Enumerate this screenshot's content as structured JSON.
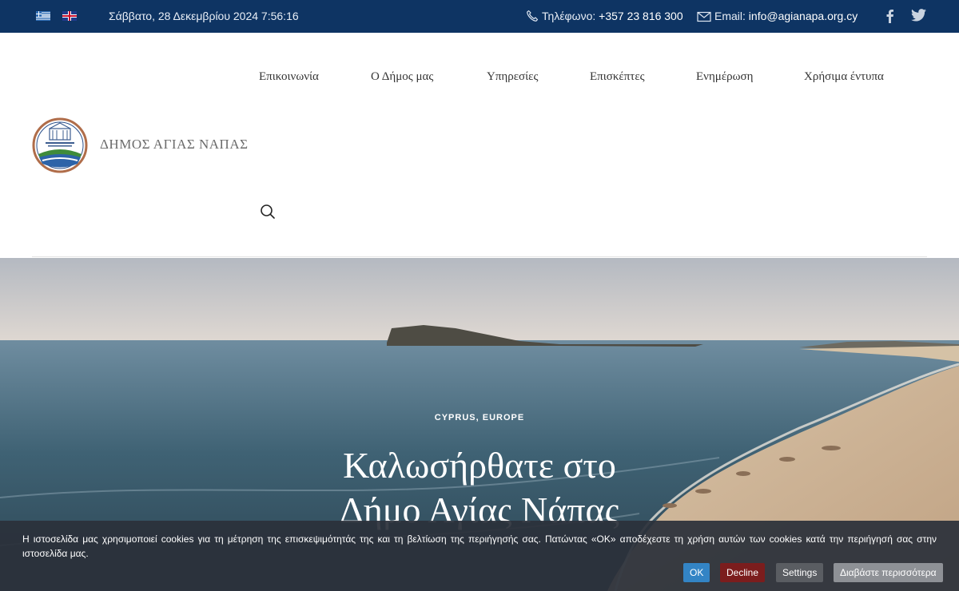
{
  "topbar": {
    "datetime": "Σάββατο, 28 Δεκεμβρίου 2024 7:56:16",
    "phone_label": "Τηλέφωνο:",
    "phone_number": "+357 23 816 300",
    "email_label": "Email:",
    "email_address": "info@agianapa.org.cy",
    "languages": [
      "greek-flag",
      "uk-flag"
    ],
    "social": [
      "facebook-icon",
      "twitter-icon"
    ],
    "bg_color": "#0e3463"
  },
  "nav": {
    "items": [
      "Επικοινωνία",
      "Ο Δήμος μας",
      "Υπηρεσίες",
      "Επισκέπτες",
      "Ενημέρωση",
      "Χρήσιμα έντυπα"
    ]
  },
  "brand": {
    "site_name": "ΔΗΜΟΣ ΑΓΙΑΣ ΝΑΠΑΣ"
  },
  "hero": {
    "category": "CYPRUS, EUROPE",
    "title_line1": "Καλωσήρθατε στο",
    "title_line2": "Δήμο Αγίας Νάπας"
  },
  "cookie": {
    "text": "Η ιστοσελίδα μας χρησιμοποιεί cookies για τη μέτρηση της επισκεψιμότητάς της και τη βελτίωση της περιήγησής σας. Πατώντας «ΟΚ» αποδέχεστε τη χρήση αυτών των cookies κατά την περιήγησή σας στην ιστοσελίδα μας.",
    "ok_label": "OK",
    "decline_label": "Decline",
    "settings_label": "Settings",
    "more_label": "Διαβάστε περισσότερα"
  }
}
